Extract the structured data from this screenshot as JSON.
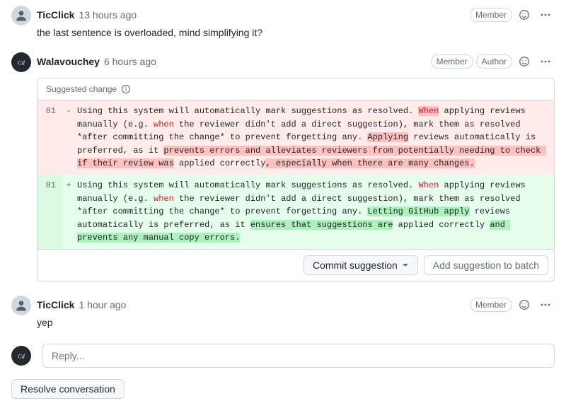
{
  "comments": [
    {
      "author": "TicClick",
      "time": "13 hours ago",
      "badges": [
        "Member"
      ],
      "body": "the last sentence is overloaded, mind simplifying it?"
    },
    {
      "author": "Walavouchey",
      "time": "6 hours ago",
      "badges": [
        "Member",
        "Author"
      ],
      "body": ""
    },
    {
      "author": "TicClick",
      "time": "1 hour ago",
      "badges": [
        "Member"
      ],
      "body": "yep"
    }
  ],
  "suggested": {
    "label": "Suggested change",
    "line_old": "81",
    "line_new": "81",
    "old_parts": [
      {
        "t": "Using this system will automatically mark suggestions as resolved. "
      },
      {
        "t": "When",
        "cls": "kw hl-del"
      },
      {
        "t": " applying reviews manually (e.g. "
      },
      {
        "t": "when",
        "cls": "kw"
      },
      {
        "t": " the reviewer didn't add a direct suggestion), mark them as resolved *after committing the change* to prevent forgetting any. "
      },
      {
        "t": "Applying",
        "cls": "hl-del"
      },
      {
        "t": " reviews automatically is preferred, as it "
      },
      {
        "t": "prevents errors and alleviates reviewers from potentially needing to check if their review was",
        "cls": "hl-del"
      },
      {
        "t": " applied correctly"
      },
      {
        "t": ", especially when there are many changes.",
        "cls": "hl-del"
      }
    ],
    "new_parts": [
      {
        "t": "Using this system will automatically mark suggestions as resolved. "
      },
      {
        "t": "When",
        "cls": "kw"
      },
      {
        "t": " applying reviews manually (e.g. "
      },
      {
        "t": "when",
        "cls": "kw"
      },
      {
        "t": " the reviewer didn't add a direct suggestion), mark them as resolved *after committing the change* to prevent forgetting any. "
      },
      {
        "t": "Letting GitHub apply",
        "cls": "hl-add"
      },
      {
        "t": " reviews automatically is preferred, as it "
      },
      {
        "t": "ensures that suggestions are",
        "cls": "hl-add"
      },
      {
        "t": " applied correctly "
      },
      {
        "t": "and prevents any manual copy errors.",
        "cls": "hl-add"
      }
    ],
    "commit_label": "Commit suggestion",
    "batch_label": "Add suggestion to batch"
  },
  "reply_placeholder": "Reply...",
  "resolve_label": "Resolve conversation"
}
